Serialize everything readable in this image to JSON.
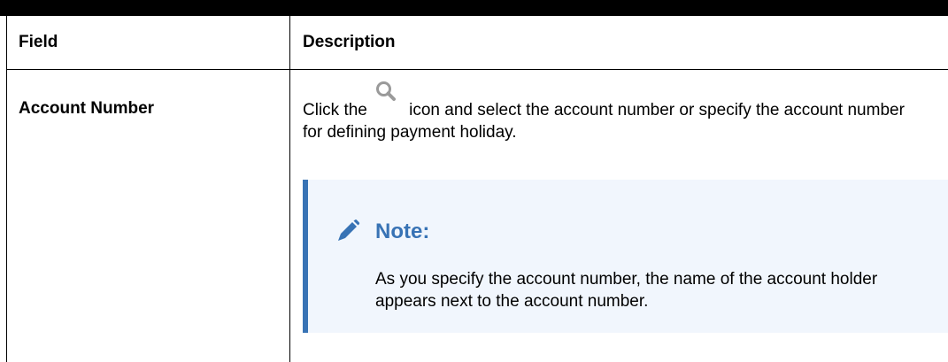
{
  "table": {
    "headers": {
      "field": "Field",
      "description": "Description"
    },
    "rows": [
      {
        "field": "Account Number",
        "description_before_icon": "Click the",
        "inline_icon": "search-icon",
        "description_after_icon": " icon and select the account number or specify the account number for defining payment holiday.",
        "note": {
          "icon": "pencil-icon",
          "title": "Note:",
          "body": "As you specify the account number, the name of the account holder appears next to the account number."
        }
      }
    ]
  },
  "colors": {
    "note_accent": "#3873b5",
    "note_background": "#f1f6fd",
    "search_icon": "#9a9a9a"
  }
}
